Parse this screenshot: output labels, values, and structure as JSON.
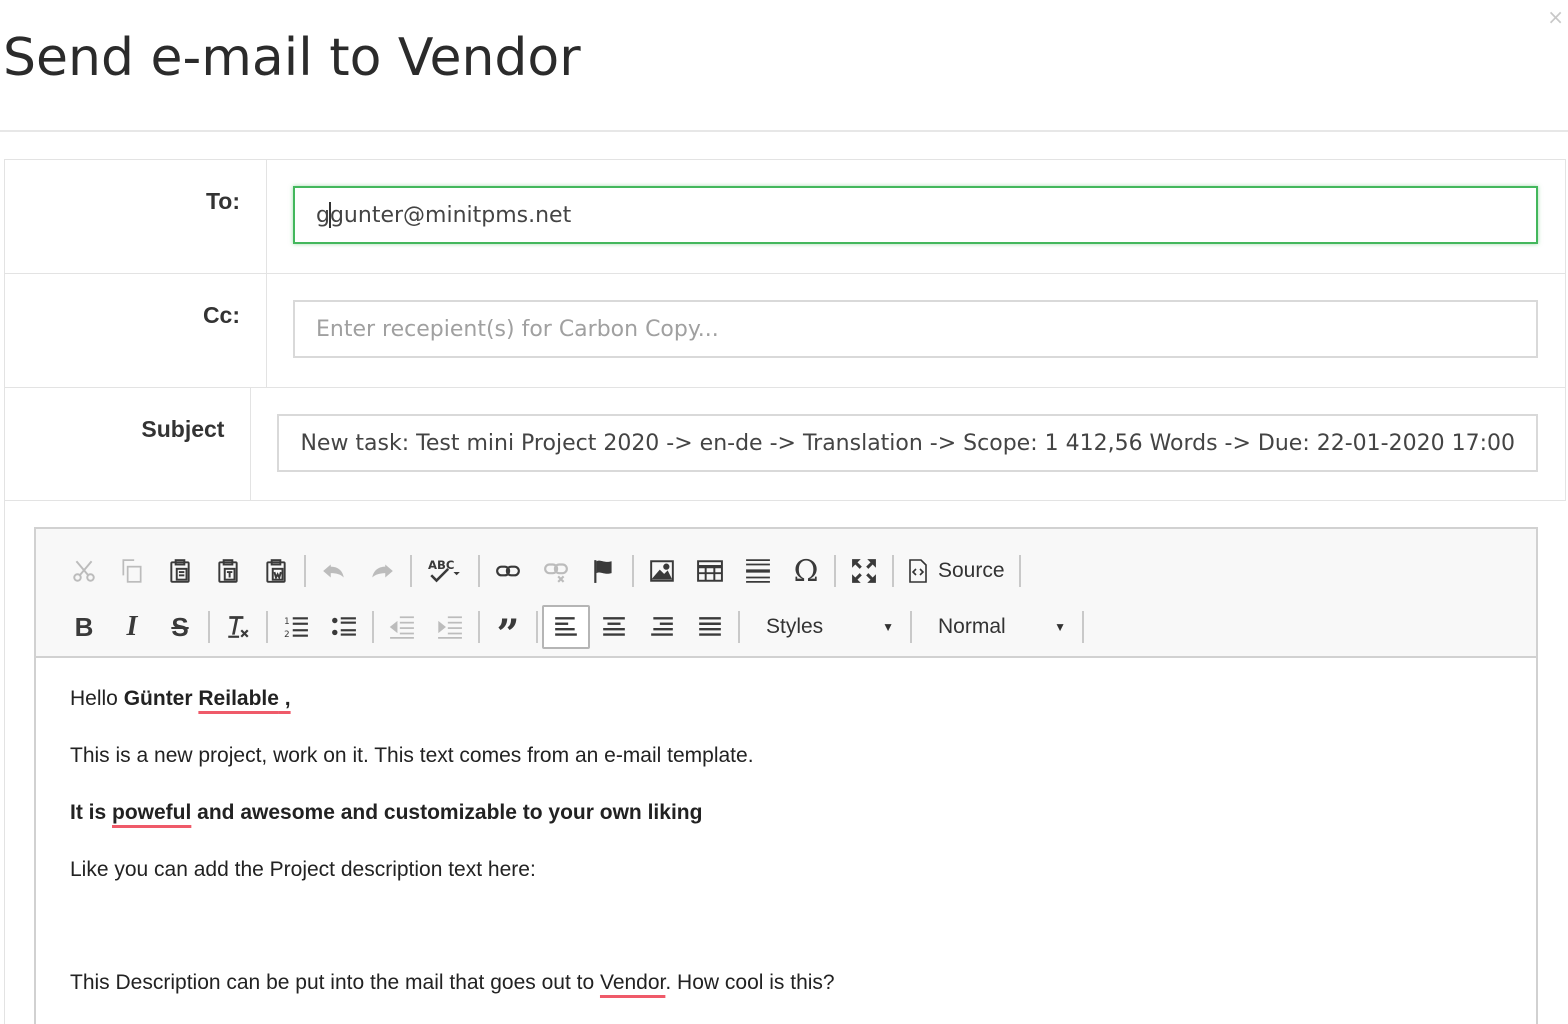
{
  "modal": {
    "title": "Send e-mail to Vendor",
    "close_glyph": "×"
  },
  "form": {
    "to": {
      "label": "To:",
      "value_prefix": "g",
      "value_rest": "gunter@minitpms.net"
    },
    "cc": {
      "label": "Cc:",
      "placeholder": "Enter recepient(s) for Carbon Copy..."
    },
    "subject": {
      "label": "Subject",
      "value": "New task: Test mini Project 2020 -> en-de -> Translation -> Scope: 1 412,56 Words -> Due: 22-01-2020 17:00"
    }
  },
  "toolbar": {
    "source_label": "Source",
    "styles_label": "Styles",
    "format_label": "Normal",
    "icons": [
      "cut-icon",
      "copy-icon",
      "paste-icon",
      "paste-text-icon",
      "paste-word-icon",
      "undo-icon",
      "redo-icon",
      "spellcheck-icon",
      "link-icon",
      "unlink-icon",
      "anchor-icon",
      "image-icon",
      "table-icon",
      "horizontal-rule-icon",
      "special-char-icon",
      "maximize-icon",
      "source-icon",
      "bold-icon",
      "italic-icon",
      "strike-icon",
      "remove-format-icon",
      "numbered-list-icon",
      "bulleted-list-icon",
      "outdent-icon",
      "indent-icon",
      "blockquote-icon",
      "align-left-icon",
      "align-center-icon",
      "align-right-icon",
      "justify-icon"
    ]
  },
  "body": {
    "greeting_prefix": "Hello ",
    "recipient_first": "Günter",
    "recipient_last": "Reilable",
    "greeting_suffix": " ,",
    "line1": "This is a new project, work on it. This text comes from an e-mail template.",
    "line2_a": "It is ",
    "line2_b": "poweful",
    "line2_c": " and awesome and customizable to your own liking",
    "line3": "Like you can add the Project description text here:",
    "line4_a": "This Description can be put into the mail that goes out to ",
    "line4_b": "Vendor",
    "line4_c": ". How cool is this?"
  },
  "colors": {
    "focus_border": "#43b75c",
    "spell_underline": "#ef5a69"
  }
}
